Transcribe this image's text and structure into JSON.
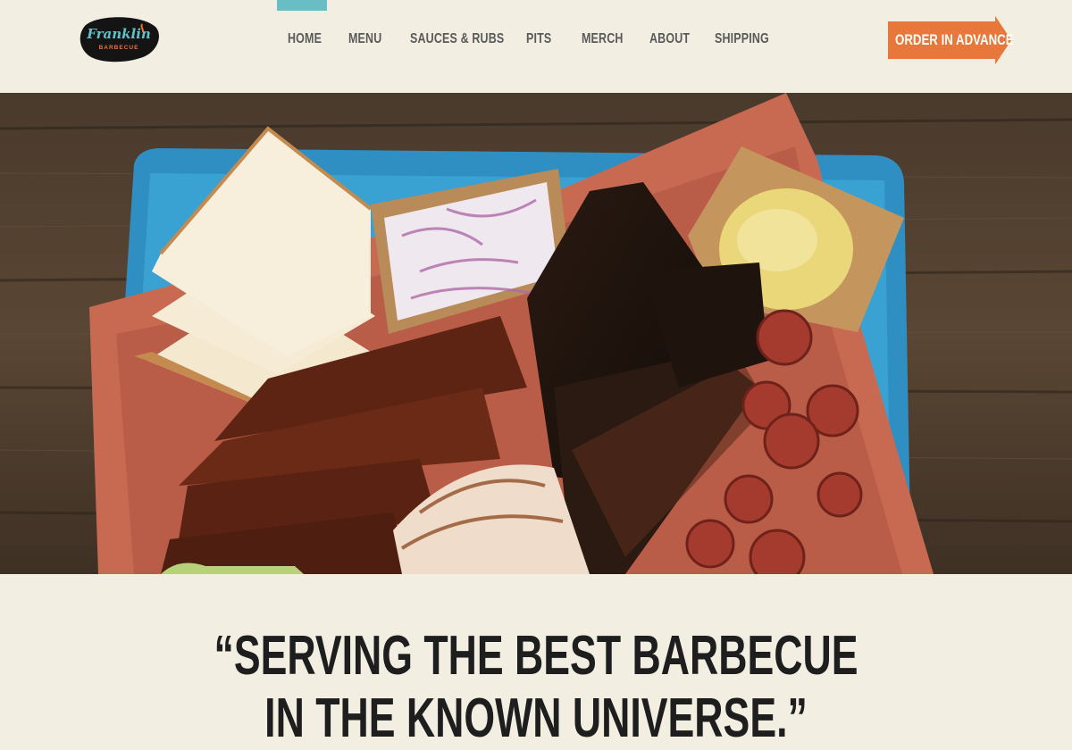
{
  "brand": {
    "name": "Franklin",
    "sub": "BARBECUE"
  },
  "nav": {
    "items": [
      "HOME",
      "MENU",
      "SAUCES & RUBS",
      "PITS",
      "MERCH",
      "ABOUT",
      "SHIPPING"
    ],
    "active": "HOME"
  },
  "cta": {
    "order_label": "ORDER IN ADVANCE"
  },
  "hero": {
    "alt": ""
  },
  "quote": {
    "line1": "“SERVING THE BEST BARBECUE",
    "line2": "IN THE KNOWN UNIVERSE.”"
  },
  "colors": {
    "background": "#f2efe2",
    "accent_teal": "#69bec5",
    "cta_orange": "#e8773b",
    "nav_text": "#5a5a5a"
  }
}
